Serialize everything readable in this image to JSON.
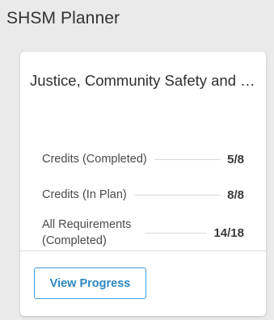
{
  "panel": {
    "title": "SHSM Planner"
  },
  "card": {
    "title": "Justice, Community Safety and Emergency Services",
    "rows": [
      {
        "label": "Credits (Completed)",
        "value": "5/8"
      },
      {
        "label": "Credits (In Plan)",
        "value": "8/8"
      },
      {
        "label": "All Requirements (Completed)",
        "value": "14/18"
      }
    ],
    "button_label": "View Progress"
  },
  "colors": {
    "background": "#eaeaea",
    "card": "#ffffff",
    "accent": "#2a86c2"
  }
}
